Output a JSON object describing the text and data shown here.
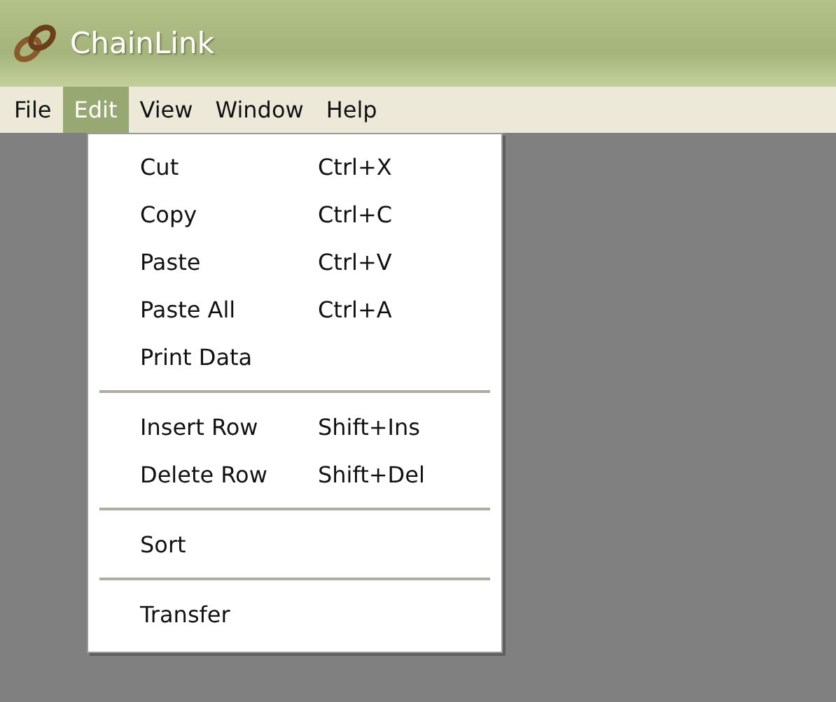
{
  "window": {
    "title": "ChainLink"
  },
  "menubar": [
    {
      "label": "File",
      "selected": false
    },
    {
      "label": "Edit",
      "selected": true
    },
    {
      "label": "View",
      "selected": false
    },
    {
      "label": "Window",
      "selected": false
    },
    {
      "label": "Help",
      "selected": false
    }
  ],
  "dropdown": [
    {
      "kind": "item",
      "label": "Cut",
      "shortcut": "Ctrl+X"
    },
    {
      "kind": "item",
      "label": "Copy",
      "shortcut": "Ctrl+C"
    },
    {
      "kind": "item",
      "label": "Paste",
      "shortcut": "Ctrl+V"
    },
    {
      "kind": "item",
      "label": "Paste All",
      "shortcut": "Ctrl+A"
    },
    {
      "kind": "item",
      "label": "Print Data"
    },
    {
      "kind": "separator"
    },
    {
      "kind": "item",
      "label": "Insert Row",
      "shortcut": "Shift+Ins"
    },
    {
      "kind": "item",
      "label": "Delete Row",
      "shortcut": "Shift+Del"
    },
    {
      "kind": "separator"
    },
    {
      "kind": "item",
      "label": "Sort"
    },
    {
      "kind": "separator"
    },
    {
      "kind": "item",
      "label": "Transfer"
    }
  ]
}
